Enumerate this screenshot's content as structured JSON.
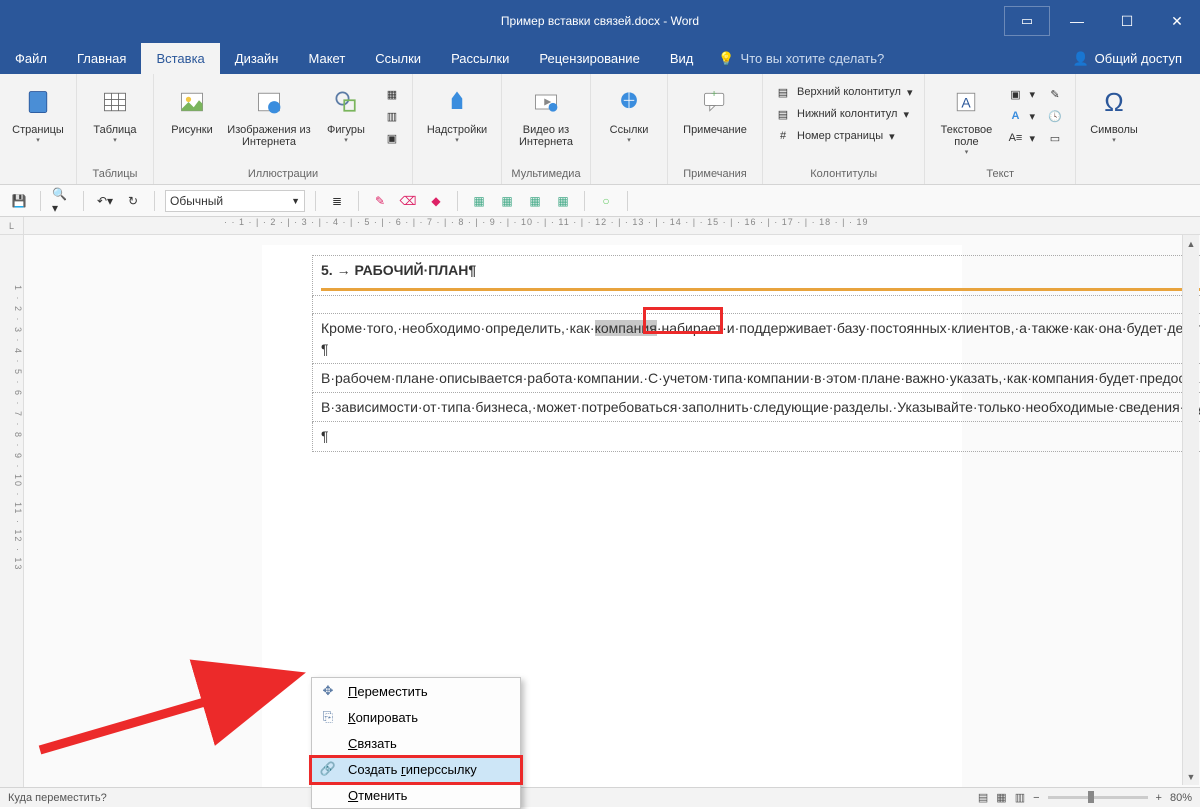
{
  "window": {
    "title_doc": "Пример вставки связей.docx",
    "title_app": "Word"
  },
  "menubar": {
    "tabs": [
      "Файл",
      "Главная",
      "Вставка",
      "Дизайн",
      "Макет",
      "Ссылки",
      "Рассылки",
      "Рецензирование",
      "Вид"
    ],
    "active_index": 2,
    "tell_me": "Что вы хотите сделать?",
    "share": "Общий доступ"
  },
  "ribbon": {
    "g_pages": {
      "label": "Страницы",
      "btn": "Страницы"
    },
    "g_tables": {
      "label": "Таблицы",
      "btn": "Таблица"
    },
    "g_illus": {
      "label": "Иллюстрации",
      "btns": [
        "Рисунки",
        "Изображения из Интернета",
        "Фигуры"
      ]
    },
    "g_addins": {
      "label": "",
      "btn": "Надстройки"
    },
    "g_media": {
      "label": "Мультимедиа",
      "btn": "Видео из Интернета"
    },
    "g_links": {
      "label": "",
      "btn": "Ссылки"
    },
    "g_comment": {
      "label": "Примечания",
      "btn": "Примечание"
    },
    "g_headers": {
      "label": "Колонтитулы",
      "items": [
        "Верхний колонтитул",
        "Нижний колонтитул",
        "Номер страницы"
      ]
    },
    "g_text": {
      "label": "Текст",
      "btn": "Текстовое поле"
    },
    "g_symbols": {
      "label": "",
      "btn": "Символы"
    }
  },
  "qat2": {
    "style": "Обычный"
  },
  "document": {
    "heading_num": "5.",
    "heading_arrow": "→",
    "heading_text": "РАБОЧИЙ·ПЛАН¶",
    "highlighted_word": "компания",
    "para1_a": "Кроме·того,·необходимо·определить,·как·",
    "para1_b": "·набирает·и·поддерживает·базу·постоянных·клиентов,·а·также·как·она·будет·делать·это·в·будущем.·Этот·раздел·включает·обязанности·руководства·с·датами·и·бюджетами,·а·также·обеспечение·отслеживания·результатов.·Каковы·прогнозируемые·этапы·будущего·роста·и·какие·возможности·необходимо·реализовать·для·роста?¶",
    "para2": "В·рабочем·плане·описывается·работа·компании.·С·учетом·типа·компании·в·этом·плане·важно·указать,·как·компания·будет·предоставлять·услуги·на·рынке·и·как·она·будет·поддерживать·клиентов.·Это·сведения·о·логистике,·технологиях,·а·также·базовых·навыках·компании.¶",
    "para3": "В·зависимости·от·типа·бизнеса,·может·потребоваться·заполнить·следующие·разделы.·Указывайте·только·необходимые·сведения·и·удалите·все·остальные.·Помните,·что·бизнес-план·должен·быть·как·можно·более·кратким.·Избыточные·подробности·в·этом·разделе·могут·сделать·план·затянутым.¶",
    "para4": "¶"
  },
  "ctx": {
    "items": [
      {
        "label": "Переместить",
        "ul": 0,
        "icon": "move"
      },
      {
        "label": "Копировать",
        "ul": 0,
        "icon": "copy"
      },
      {
        "label": "Связать",
        "ul": 0,
        "icon": ""
      },
      {
        "label": "Создать гиперссылку",
        "ul": 8,
        "icon": "link"
      },
      {
        "label": "Отменить",
        "ul": 0,
        "icon": ""
      }
    ],
    "highlight_index": 3
  },
  "status": {
    "left": "Куда переместить?",
    "zoom": "80%"
  },
  "hruler": "· · 1 · | · 2 · | · 3 · | · 4 · | · 5 · | · 6 · | · 7 · | · 8 · | · 9 · | · 10 · | · 11 · | · 12 · | · 13 · | · 14 · | · 15 · | · 16 · | · 17 · | · 18 · | · 19",
  "vruler": "1 · 2 · 3 · 4 · 5 · 6 · 7 · 8 · 9 · 10 · 11 · 12 · 13"
}
